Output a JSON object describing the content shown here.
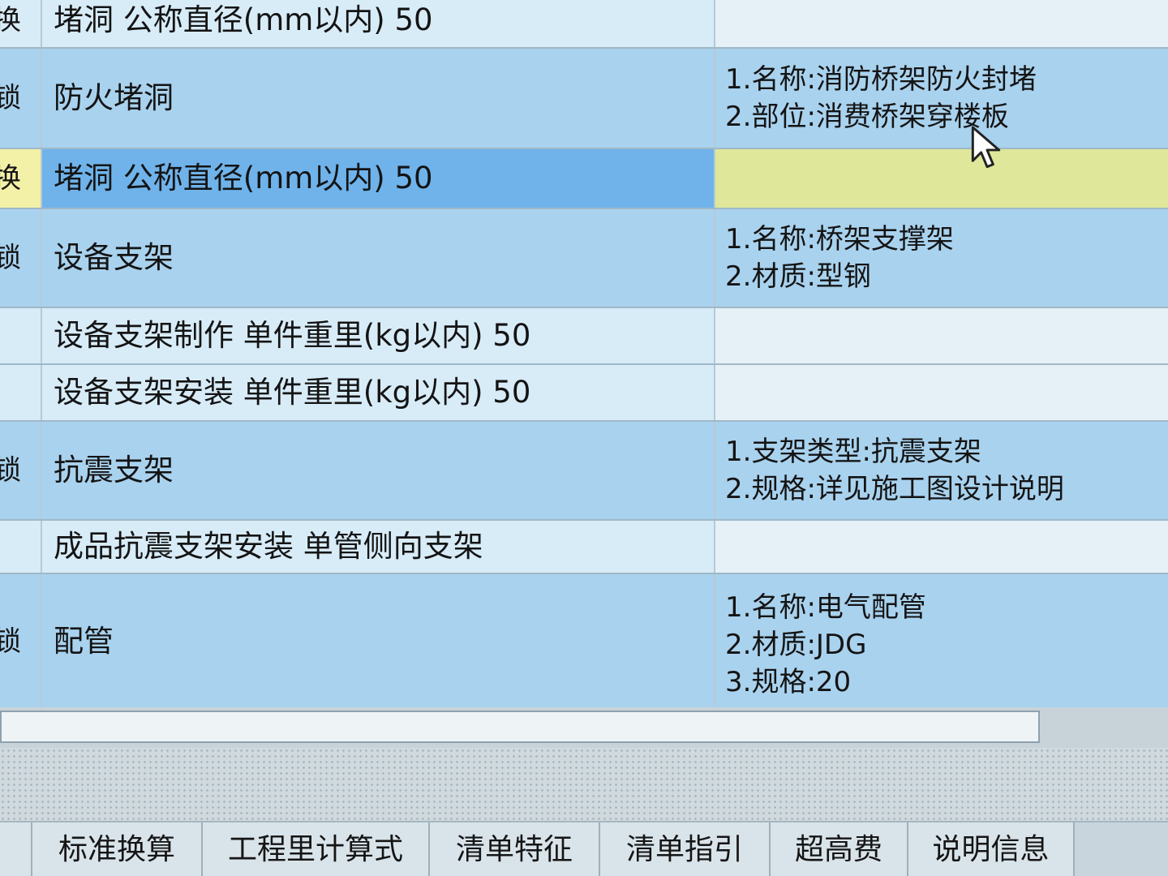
{
  "rows": [
    {
      "flag": "换",
      "name": "堵洞 公称直径(mm以内) 50",
      "feature": ""
    },
    {
      "flag": "锁",
      "name": "防火堵洞",
      "feature": "1.名称:消防桥架防火封堵\n2.部位:消费桥架穿楼板"
    },
    {
      "flag": "换",
      "name": "堵洞 公称直径(mm以内) 50",
      "feature": ""
    },
    {
      "flag": "锁",
      "name": "设备支架",
      "feature": "1.名称:桥架支撑架\n2.材质:型钢"
    },
    {
      "flag": "",
      "name": "设备支架制作 单件重里(kg以内) 50",
      "feature": ""
    },
    {
      "flag": "",
      "name": "设备支架安装 单件重里(kg以内) 50",
      "feature": ""
    },
    {
      "flag": "锁",
      "name": "抗震支架",
      "feature": "1.支架类型:抗震支架\n2.规格:详见施工图设计说明"
    },
    {
      "flag": "",
      "name": "成品抗震支架安装 单管侧向支架",
      "feature": ""
    },
    {
      "flag": "锁",
      "name": "配管",
      "feature": "1.名称:电气配管\n2.材质:JDG\n3.规格:20"
    }
  ],
  "tabs": [
    "标准换算",
    "工程里计算式",
    "清单特征",
    "清单指引",
    "超高费",
    "说明信息"
  ]
}
